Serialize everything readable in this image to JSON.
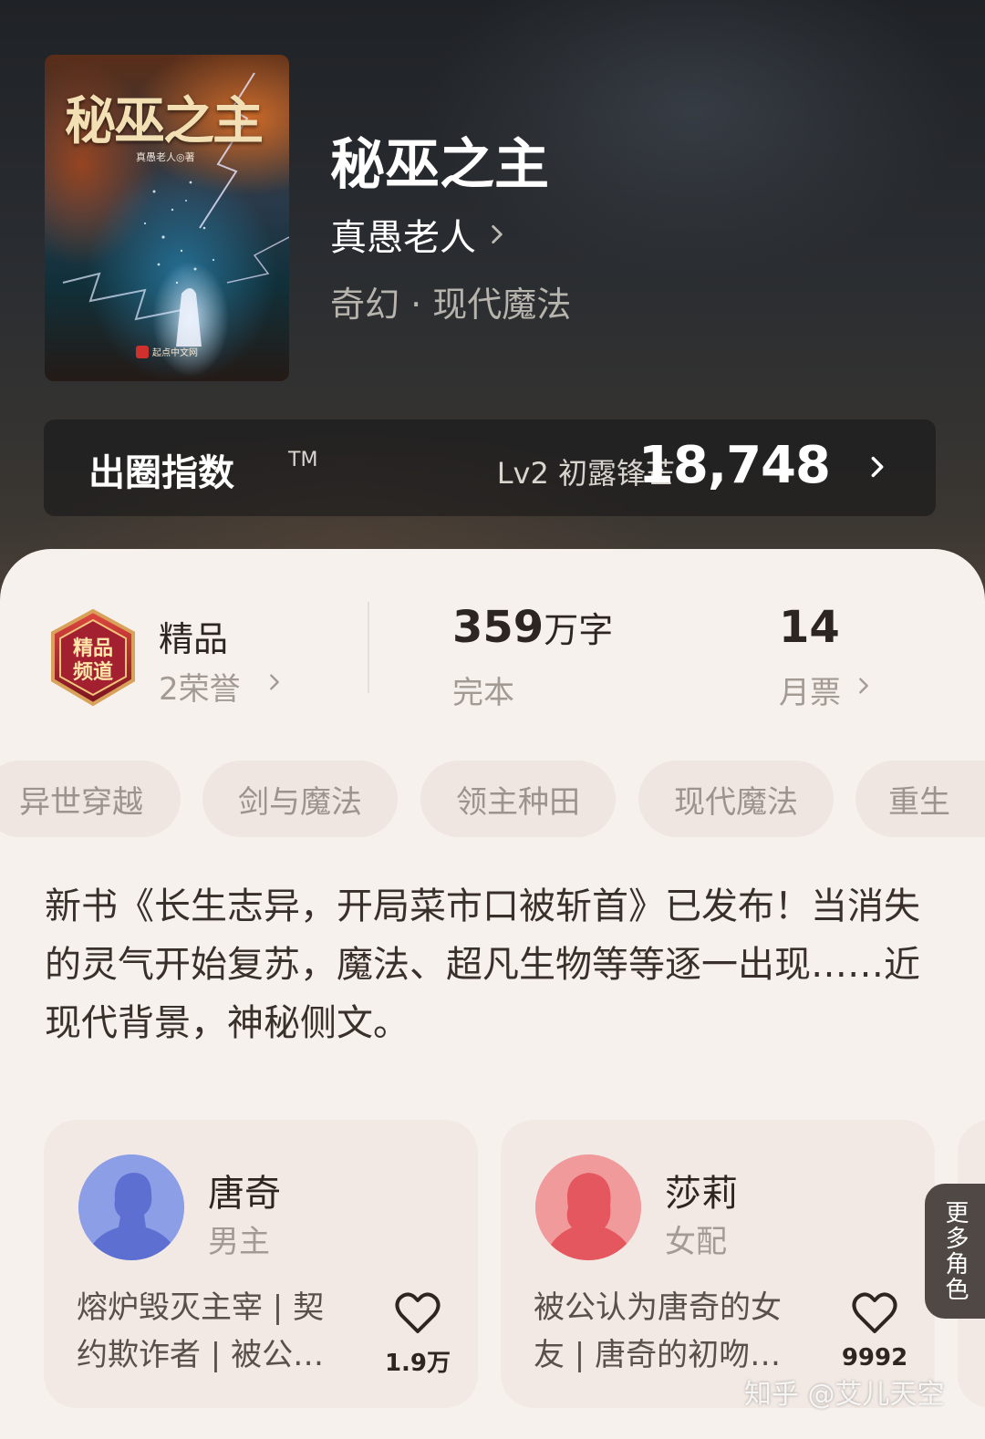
{
  "book": {
    "cover_title": "秘巫之主",
    "cover_author": "真愚老人◎著",
    "cover_publisher": "起点中文网",
    "title": "秘巫之主",
    "author": "真愚老人",
    "genre": "奇幻 · 现代魔法"
  },
  "index_bar": {
    "label": "出圈指数",
    "tm": "TM",
    "level": "Lv2 初露锋芒",
    "value": "18,748"
  },
  "stats": {
    "badge_title": "精品",
    "badge_sub": "2荣誉",
    "words_num": "359",
    "words_unit": "万字",
    "status": "完本",
    "monthly_num": "14",
    "monthly_label": "月票"
  },
  "tags": [
    "异世穿越",
    "剑与魔法",
    "领主种田",
    "现代魔法",
    "重生"
  ],
  "intro": "新书《长生志异，开局菜市口被斩首》已发布！当消失的灵气开始复苏，魔法、超凡生物等等逐一出现……近现代背景，神秘侧文。",
  "roles": [
    {
      "name": "唐奇",
      "type": "男主",
      "desc": "熔炉毁灭主宰 | 契约欺诈者 | 被公…",
      "likes": "1.9万"
    },
    {
      "name": "莎莉",
      "type": "女配",
      "desc": "被公认为唐奇的女友 | 唐奇的初吻…",
      "likes": "9992"
    }
  ],
  "more_roles_label": "更多角色",
  "watermark": "知乎 @艾儿天空",
  "colors": {
    "header_bg": "#25282c",
    "card_bg": "#f7f1ed",
    "tag_bg": "#efe6e1",
    "male_avatar": "#8c9ee6",
    "female_avatar": "#f19a9c"
  }
}
